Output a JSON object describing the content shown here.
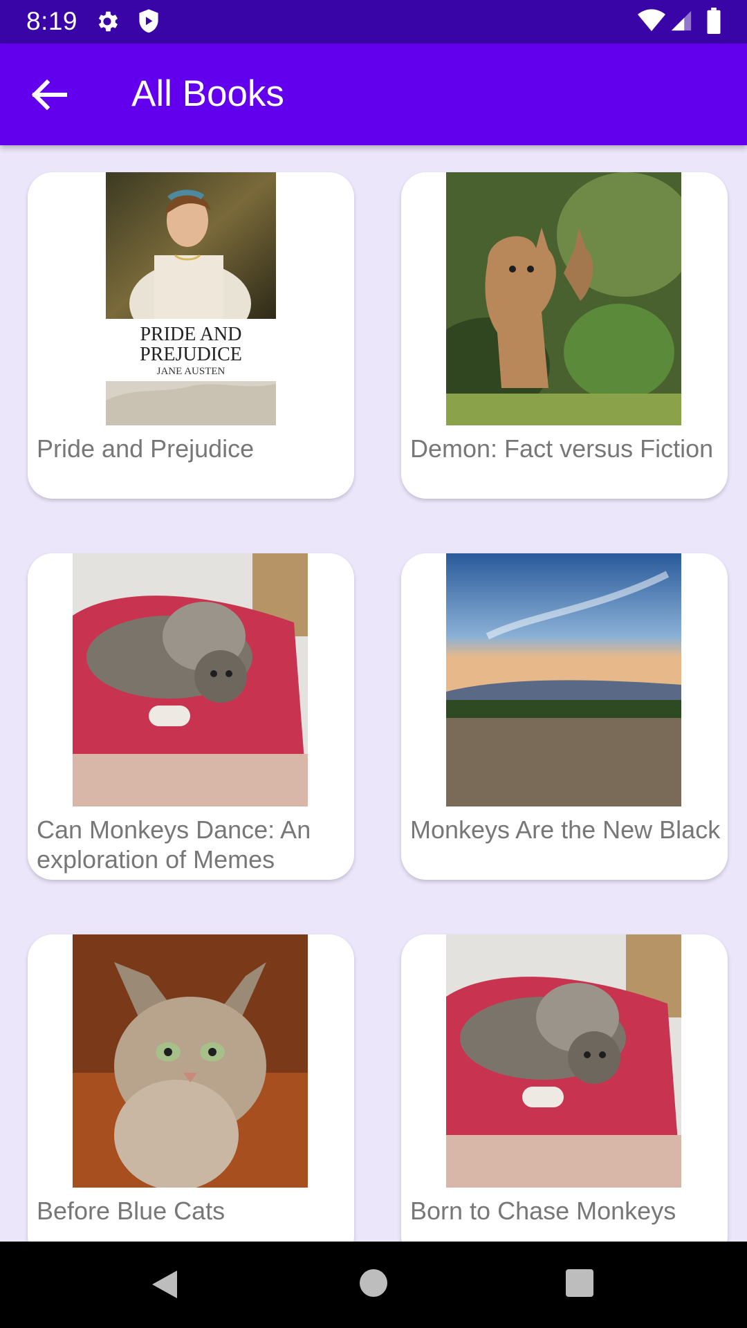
{
  "status_bar": {
    "time": "8:19",
    "icons": [
      "gear-icon",
      "shield-icon",
      "wifi-icon",
      "signal-icon",
      "battery-icon"
    ]
  },
  "app_bar": {
    "title": "All Books",
    "back_icon": "arrow-back-icon",
    "color": "#6200ee"
  },
  "books": [
    {
      "title": "Pride and Prejudice",
      "cover": "book-cover-portrait-woman",
      "cover_text_line1": "PRIDE AND",
      "cover_text_line2": "PREJUDICE",
      "cover_text_author": "JANE AUSTEN"
    },
    {
      "title": "Demon: Fact versus Fiction",
      "cover": "lynx-photo"
    },
    {
      "title": "Can Monkeys Dance: An exploration of Memes",
      "cover": "kittens-on-bag-photo"
    },
    {
      "title": "Monkeys Are the New Black",
      "cover": "sky-landscape-photo"
    },
    {
      "title": "Before Blue Cats",
      "cover": "tabby-cat-photo"
    },
    {
      "title": "Born to Chase Monkeys",
      "cover": "kittens-on-bag-photo"
    }
  ],
  "nav_bar": {
    "icons": [
      "nav-back-icon",
      "nav-home-icon",
      "nav-recents-icon"
    ]
  },
  "colors": {
    "status_bar": "#3a05a6",
    "background": "#ece6fb"
  }
}
